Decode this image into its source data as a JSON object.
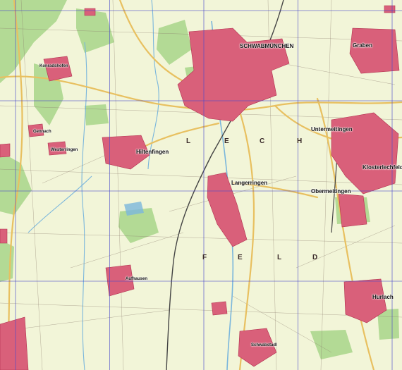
{
  "map": {
    "type": "topographic",
    "colors": {
      "background": "#f2f5d8",
      "forest": "#a8d58a",
      "settlement": "#d9607a",
      "settlement_outline": "#b2304f",
      "main_road": "#e8c060",
      "water": "#7ab6dc",
      "grid": "#4a4acc",
      "railway": "#444444",
      "minor_road": "#8a7a6a"
    },
    "places": {
      "schwabmuenchen": "SCHWABMÜNCHEN",
      "graben": "Graben",
      "untermeitingen": "Untermeitingen",
      "klosterlechfeld": "Klosterlechfeld",
      "obermeitingen": "Obermeitingen",
      "langerringen": "Langerringen",
      "hiltenfingen": "Hiltenfingen",
      "hurlach": "Hurlach",
      "schwabstadl": "Schwabstadl",
      "konradshofen": "Konradshofen",
      "gennach": "Gennach",
      "westerringen": "Westerringen",
      "aufhausen": "Aufhausen"
    },
    "landscape_name_letters": {
      "lech": [
        "L",
        "E",
        "C",
        "H"
      ],
      "feld": [
        "F",
        "E",
        "L",
        "D"
      ]
    }
  }
}
